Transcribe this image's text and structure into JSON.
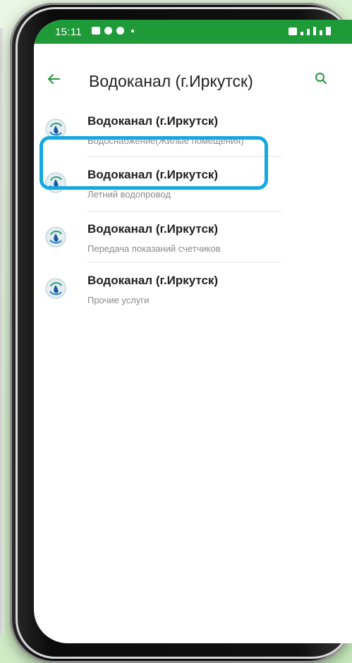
{
  "status_bar": {
    "time": "15:11"
  },
  "app_bar": {
    "back_icon": "arrow-left-icon",
    "title": "Водоканал (г.Иркутск)",
    "search_icon": "search-icon"
  },
  "list": {
    "items": [
      {
        "title": "Водоканал (г.Иркутск)",
        "subtitle": "Водоснабжение(Жилые помещения)",
        "icon": "water-drop-logo-icon"
      },
      {
        "title": "Водоканал (г.Иркутск)",
        "subtitle": "Летний водопровод",
        "icon": "water-drop-logo-icon",
        "highlighted": true
      },
      {
        "title": "Водоканал (г.Иркутск)",
        "subtitle": "Передача показаний счетчиков",
        "icon": "water-drop-logo-icon"
      },
      {
        "title": "Водоканал (г.Иркутск)",
        "subtitle": "Прочие услуги",
        "icon": "water-drop-logo-icon"
      }
    ]
  },
  "colors": {
    "status_bar": "#1f9a38",
    "accent": "#1f9a38",
    "highlight": "#16a9e1",
    "background": "#d5eecc"
  }
}
